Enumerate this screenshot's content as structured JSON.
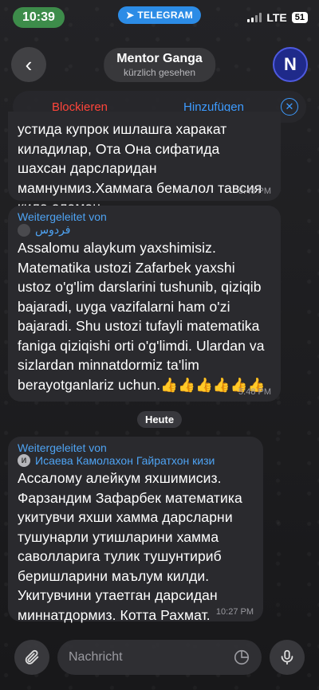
{
  "status_bar": {
    "time": "10:39",
    "app_badge": "TELEGRAM",
    "network": "LTE",
    "battery": "51"
  },
  "header": {
    "contact_name": "Mentor Ganga",
    "last_seen": "kürzlich gesehen",
    "avatar_letter": "N"
  },
  "action_bar": {
    "block_label": "Blockieren",
    "add_label": "Hinzufügen"
  },
  "messages": [
    {
      "text": "устида купрок ишлашга харакат киладилар, Ота Она сифатида шахсан дарсларидан мамнунмиз.Хаммага бемалол тавсия кила оламан.",
      "time": "5:48 PM"
    },
    {
      "forward_label": "Weitergeleitet von",
      "forward_from": "فردوس",
      "text": "Assalomu alaykum yaxshimisiz. Matematika ustozi Zafarbek yaxshi ustoz o'g'lim darslarini  tushunib, qiziqib bajaradi, uyga vazifalarni ham o'zi bajaradi. Shu ustozi tufayli matematika faniga qiziqishi orti o'g'limdi. Ulardan va sizlardan minnatdormiz ta'lim berayotganlariz uchun.👍👍👍👍👍👍",
      "time": "5:48 PM"
    },
    {
      "forward_label": "Weitergeleitet von",
      "forward_from": "Исаева Камолахон Гайратхон кизи",
      "forward_avatar": "И",
      "text": "Ассалому алейкум яхшимисиз. Фарзандим Зафарбек математика укитувчи яхши хамма дарсларни тушунарли утишларини хамма саволларига тулик тушунтириб беришларини маълум килди. Укитувчини утаетган дарсидан миннатдормиз. Котта Рахмат.",
      "time": "10:27 PM"
    }
  ],
  "date_divider": "Heute",
  "input": {
    "placeholder": "Nachricht"
  }
}
